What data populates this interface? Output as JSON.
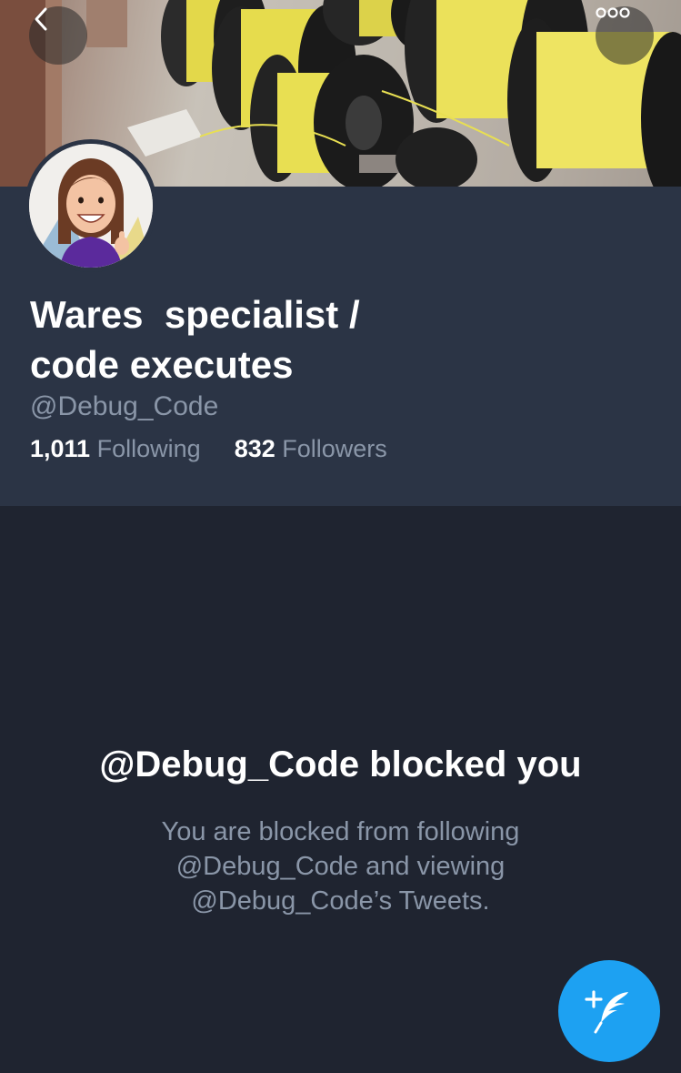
{
  "header": {
    "back_icon": "chevron-left-icon",
    "more_icon": "more-horizontal-icon",
    "banner_image": "cable spools photo"
  },
  "profile": {
    "display_name": "Wares  specialist /\ncode executes",
    "handle": "@Debug_Code",
    "following_count": "1,011",
    "following_label": "Following",
    "followers_count": "832",
    "followers_label": "Followers"
  },
  "blocked": {
    "title": "@Debug_Code blocked you",
    "message": "You are blocked from following @Debug_Code and viewing @Debug_Code’s Tweets."
  },
  "compose": {
    "icon": "compose-tweet-icon"
  },
  "colors": {
    "background": "#1f2430",
    "profile_panel": "#2b3445",
    "text_primary": "#ffffff",
    "text_secondary": "#8a96a8",
    "accent": "#1da1f2"
  }
}
